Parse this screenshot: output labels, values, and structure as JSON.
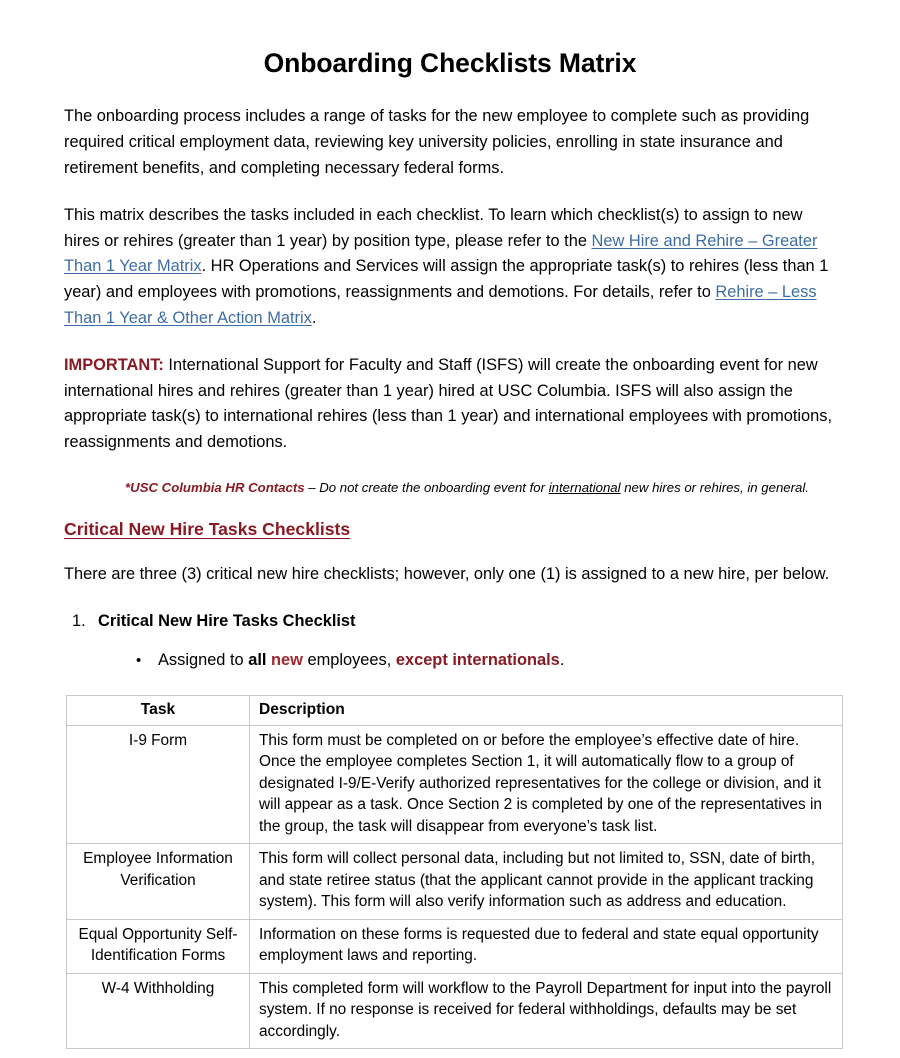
{
  "document": {
    "title": "Onboarding Checklists Matrix"
  },
  "paragraphs": {
    "intro": "The onboarding process includes a range of tasks for the new employee to complete such as providing required critical employment data, reviewing key university policies, enrolling in state insurance and retirement benefits, and completing necessary federal forms.",
    "matrix_p1": "This matrix describes the tasks included in each checklist. To learn which checklist(s) to assign to new hires or rehires (greater than 1 year) by position type, please refer to the ",
    "link_1": "New Hire and Rehire – Greater Than 1 Year Matrix",
    "matrix_p2": ". HR Operations and Services will assign the appropriate task(s) to rehires (less than 1 year) and employees with promotions, reassignments and demotions. For details, refer to ",
    "link_2": "Rehire – Less Than 1 Year & Other Action Matrix",
    "matrix_p3": ".",
    "important_label": "IMPORTANT:",
    "important_body": " International Support for Faculty and Staff (ISFS) will create the onboarding event for new international hires and rehires (greater than 1 year) hired at USC Columbia. ISFS will also assign the appropriate task(s) to international rehires (less than 1 year) and international employees with promotions, reassignments and demotions.",
    "three_checklists": "There are three (3) critical new hire checklists; however, only one (1) is assigned to a new hire, per below."
  },
  "hr_note": {
    "lead": "*USC Columbia HR Contacts",
    "rest_1": " – Do not create the onboarding event for ",
    "emphasis": "international",
    "rest_2": " new hires or rehires, in general."
  },
  "section": {
    "heading": "Critical New Hire Tasks Checklists"
  },
  "numbered_list": [
    {
      "number": "1.",
      "label": "Critical New Hire Tasks Checklist"
    }
  ],
  "bullets": [
    {
      "marker": "•",
      "part_1": "Assigned to ",
      "bold_black": "all",
      "space_1": " ",
      "bold_red": "new",
      "part_2": " employees, ",
      "bold_garnet": "except internationals",
      "part_3": "."
    }
  ],
  "table": {
    "columns": [
      "Task",
      "Description"
    ],
    "rows": [
      {
        "task": "I-9 Form",
        "description": "This form must be completed on or before the employee’s effective date of hire. Once the employee completes Section 1, it will automatically flow to a group of designated I-9/E-Verify authorized representatives for the college or division, and it will appear as a task. Once Section 2 is completed by one of the representatives in the group, the task will disappear from everyone’s task list."
      },
      {
        "task": "Employee Information Verification",
        "description": "This form will collect personal data, including but not limited to, SSN, date of birth, and state retiree status (that the applicant cannot provide in the applicant tracking system). This form will also verify information such as address and education."
      },
      {
        "task": "Equal Opportunity Self-Identification Forms",
        "description": "Information on these forms is requested due to federal and state equal opportunity employment laws and reporting."
      },
      {
        "task": "W-4 Withholding",
        "description": "This completed form will workflow to the Payroll Department for input into the payroll system. If no response is received for federal withholdings, defaults may be set accordingly."
      }
    ]
  },
  "colors": {
    "garnet": "#8A1A23",
    "red": "#A32630",
    "link_blue": "#3E6DA5",
    "table_border": "#C8C8C8"
  }
}
